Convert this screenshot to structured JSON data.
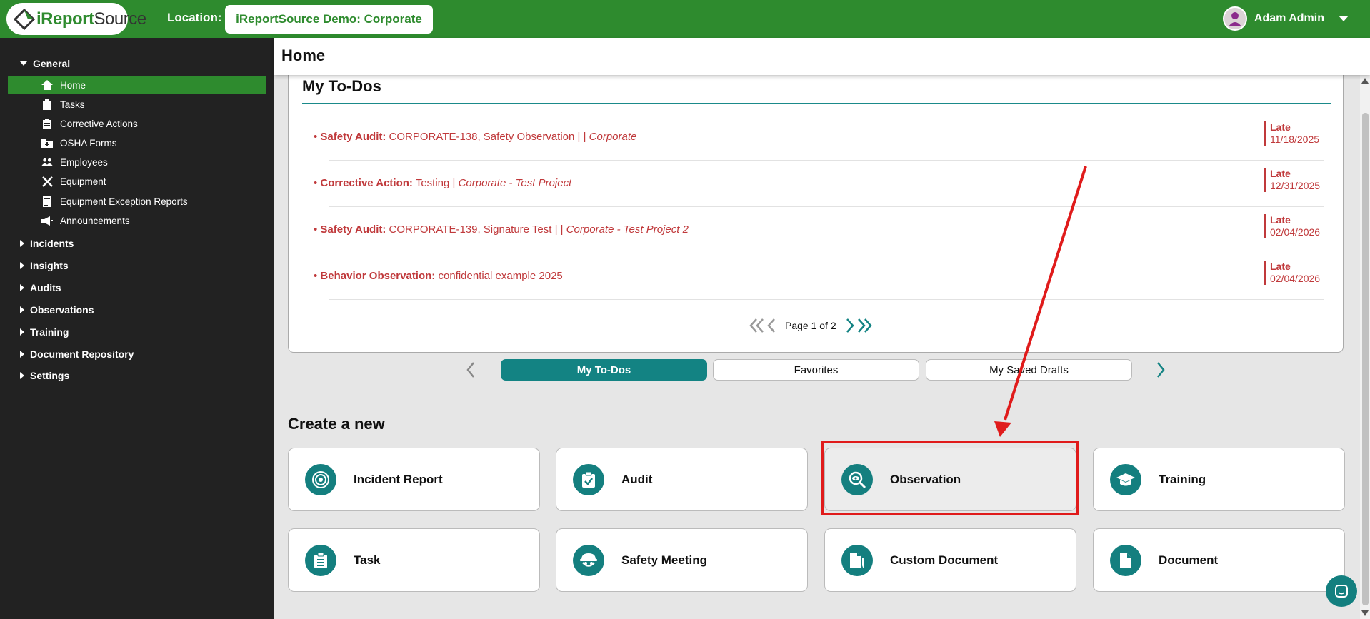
{
  "app": {
    "logo_text_prefix": "i",
    "logo_text_main": "Report",
    "logo_text_suffix": "Source",
    "location_label": "Location:",
    "location_value": "iReportSource Demo: Corporate",
    "user_name": "Adam Admin",
    "brand_color": "#2e8b2e",
    "accent_color": "#138383",
    "alert_color": "#c0393b"
  },
  "sidebar": {
    "general": "General",
    "items": [
      {
        "label": "Home",
        "icon": "home-icon",
        "active": true
      },
      {
        "label": "Tasks",
        "icon": "clipboard-icon"
      },
      {
        "label": "Corrective Actions",
        "icon": "clipboard-icon"
      },
      {
        "label": "OSHA Forms",
        "icon": "folder-plus-icon"
      },
      {
        "label": "Employees",
        "icon": "users-icon"
      },
      {
        "label": "Equipment",
        "icon": "tools-icon"
      },
      {
        "label": "Equipment Exception Reports",
        "icon": "report-icon"
      },
      {
        "label": "Announcements",
        "icon": "megaphone-icon"
      }
    ],
    "groups": [
      "Incidents",
      "Insights",
      "Audits",
      "Observations",
      "Training",
      "Document Repository",
      "Settings"
    ]
  },
  "header": {
    "title": "Home"
  },
  "todos": {
    "title": "My To-Dos",
    "items": [
      {
        "type": "Safety Audit:",
        "text": "CORPORATE-138, Safety Observation |  |",
        "location": "Corporate",
        "status": "Late",
        "date": "11/18/2025"
      },
      {
        "type": "Corrective Action:",
        "text": "Testing |",
        "location": "Corporate - Test Project",
        "status": "Late",
        "date": "12/31/2025"
      },
      {
        "type": "Safety Audit:",
        "text": "CORPORATE-139, Signature Test |  |",
        "location": "Corporate - Test Project 2",
        "status": "Late",
        "date": "02/04/2026"
      },
      {
        "type": "Behavior Observation:",
        "text": "confidential example 2025",
        "location": "",
        "status": "Late",
        "date": "02/04/2026"
      }
    ],
    "pager": "Page 1 of 2"
  },
  "tabs": [
    "My To-Dos",
    "Favorites",
    "My Saved Drafts"
  ],
  "create": {
    "title": "Create a new",
    "tiles": [
      {
        "label": "Incident Report",
        "icon": "target-icon"
      },
      {
        "label": "Audit",
        "icon": "clipboard-check-icon"
      },
      {
        "label": "Observation",
        "icon": "eye-search-icon"
      },
      {
        "label": "Training",
        "icon": "graduation-cap-icon"
      },
      {
        "label": "Task",
        "icon": "clipboard-list-icon"
      },
      {
        "label": "Safety Meeting",
        "icon": "hard-hat-icon"
      },
      {
        "label": "Custom Document",
        "icon": "custom-doc-icon"
      },
      {
        "label": "Document",
        "icon": "document-icon"
      }
    ]
  }
}
